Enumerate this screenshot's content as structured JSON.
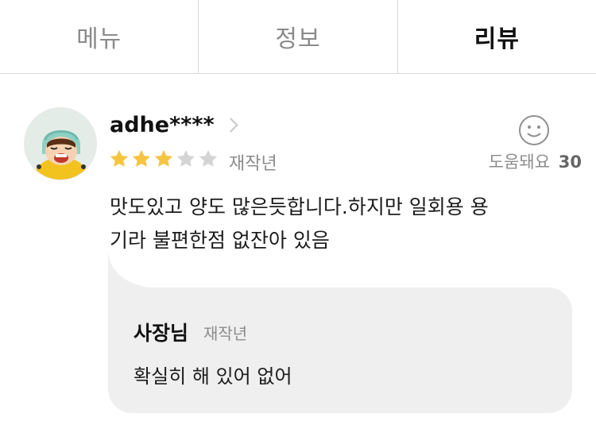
{
  "tabs": [
    {
      "label": "메뉴",
      "active": false
    },
    {
      "label": "정보",
      "active": false
    },
    {
      "label": "리뷰",
      "active": true
    }
  ],
  "review": {
    "username": "adhe****",
    "rating": 3,
    "max_rating": 5,
    "date": "재작년",
    "helpful_label": "도움돼요",
    "helpful_count": "30",
    "text_line1": "맛도있고 양도 많은듯합니다.하지만 일회용 용",
    "text_line2": "기라 불편한점 없잔아 있음",
    "star_color": "#f5c542",
    "star_empty_color": "#d4d4d4"
  },
  "reply": {
    "name": "사장님",
    "date": "재작년",
    "text": "확실히 해 있어 없어"
  }
}
